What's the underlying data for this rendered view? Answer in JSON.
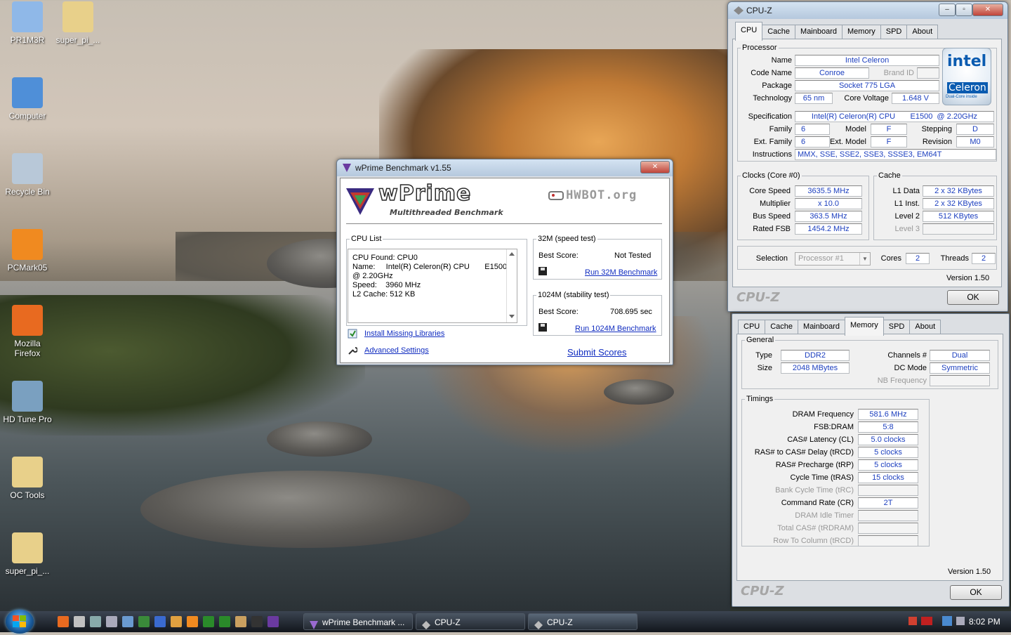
{
  "desktop": {
    "icons": [
      {
        "label": "PR1M3R",
        "color": "#8fb8e8"
      },
      {
        "label": "super_pi_...",
        "color": "#e8d08a"
      },
      {
        "label": "Computer",
        "color": "#4f8fd8"
      },
      {
        "label": "Recycle Bin",
        "color": "#b8c8d8"
      },
      {
        "label": "PCMark05",
        "color": "#f08a20"
      },
      {
        "label": "Mozilla Firefox",
        "color": "#e86a20"
      },
      {
        "label": "HD Tune Pro",
        "color": "#7aa0c0"
      },
      {
        "label": "OC Tools",
        "color": "#e8d08a"
      },
      {
        "label": "super_pi_...",
        "color": "#e8d08a"
      }
    ]
  },
  "wprime": {
    "title": "wPrime Benchmark v1.55",
    "logo": "wPrime",
    "logo_sub": "Multithreaded Benchmark",
    "hwbot": "HWBOT.org",
    "cpu_list": {
      "legend": "CPU List",
      "lines": [
        "CPU Found: CPU0",
        "Name:     Intel(R) Celeron(R) CPU       E1500",
        "@ 2.20GHz",
        "Speed:    3960 MHz",
        "L2 Cache: 512 KB"
      ]
    },
    "install_link": "Install Missing Libraries",
    "advanced_link": "Advanced Settings",
    "test32": {
      "legend": "32M (speed test)",
      "best_label": "Best Score:",
      "best_value": "Not Tested",
      "run": "Run 32M Benchmark"
    },
    "test1024": {
      "legend": "1024M (stability test)",
      "best_label": "Best Score:",
      "best_value": "708.695 sec",
      "run": "Run 1024M Benchmark"
    },
    "submit": "Submit Scores",
    "close_btn": "✕"
  },
  "cpuz1": {
    "title": "CPU-Z",
    "tabs": [
      "CPU",
      "Cache",
      "Mainboard",
      "Memory",
      "SPD",
      "About"
    ],
    "active_tab": "CPU",
    "processor": {
      "legend": "Processor",
      "name_label": "Name",
      "name": "Intel Celeron",
      "codename_label": "Code Name",
      "codename": "Conroe",
      "brand_label": "Brand ID",
      "package_label": "Package",
      "package": "Socket 775 LGA",
      "tech_label": "Technology",
      "tech": "65 nm",
      "voltage_label": "Core Voltage",
      "voltage": "1.648 V",
      "spec_label": "Specification",
      "spec": "Intel(R) Celeron(R) CPU       E1500  @ 2.20GHz",
      "family_label": "Family",
      "family": "6",
      "model_label": "Model",
      "model": "F",
      "stepping_label": "Stepping",
      "stepping": "D",
      "extfamily_label": "Ext. Family",
      "extfamily": "6",
      "extmodel_label": "Ext. Model",
      "extmodel": "F",
      "revision_label": "Revision",
      "revision": "M0",
      "instr_label": "Instructions",
      "instr": "MMX, SSE, SSE2, SSE3, SSSE3, EM64T"
    },
    "intel_logo": {
      "brand": "intel",
      "product": "Celeron",
      "tag": "Dual-Core inside"
    },
    "clocks": {
      "legend": "Clocks (Core #0)",
      "core_speed_label": "Core Speed",
      "core_speed": "3635.5 MHz",
      "multiplier_label": "Multiplier",
      "multiplier": "x 10.0",
      "bus_speed_label": "Bus Speed",
      "bus_speed": "363.5 MHz",
      "rated_fsb_label": "Rated FSB",
      "rated_fsb": "1454.2 MHz"
    },
    "cache": {
      "legend": "Cache",
      "l1d_label": "L1 Data",
      "l1d": "2 x 32 KBytes",
      "l1i_label": "L1 Inst.",
      "l1i": "2 x 32 KBytes",
      "l2_label": "Level 2",
      "l2": "512 KBytes",
      "l3_label": "Level 3"
    },
    "selection_label": "Selection",
    "selection": "Processor #1",
    "cores_label": "Cores",
    "cores": "2",
    "threads_label": "Threads",
    "threads": "2",
    "version": "Version 1.50",
    "brand": "CPU-Z",
    "ok": "OK"
  },
  "cpuz2": {
    "tabs": [
      "CPU",
      "Cache",
      "Mainboard",
      "Memory",
      "SPD",
      "About"
    ],
    "active_tab": "Memory",
    "general": {
      "legend": "General",
      "type_label": "Type",
      "type": "DDR2",
      "size_label": "Size",
      "size": "2048 MBytes",
      "channels_label": "Channels #",
      "channels": "Dual",
      "dcmode_label": "DC Mode",
      "dcmode": "Symmetric",
      "nbfreq_label": "NB Frequency"
    },
    "timings": {
      "legend": "Timings",
      "rows": [
        {
          "label": "DRAM Frequency",
          "value": "581.6 MHz",
          "gray": false
        },
        {
          "label": "FSB:DRAM",
          "value": "5:8",
          "gray": false
        },
        {
          "label": "CAS# Latency (CL)",
          "value": "5.0 clocks",
          "gray": false
        },
        {
          "label": "RAS# to CAS# Delay (tRCD)",
          "value": "5 clocks",
          "gray": false
        },
        {
          "label": "RAS# Precharge (tRP)",
          "value": "5 clocks",
          "gray": false
        },
        {
          "label": "Cycle Time (tRAS)",
          "value": "15 clocks",
          "gray": false
        },
        {
          "label": "Bank Cycle Time (tRC)",
          "value": "",
          "gray": true
        },
        {
          "label": "Command Rate (CR)",
          "value": "2T",
          "gray": false
        },
        {
          "label": "DRAM Idle Timer",
          "value": "",
          "gray": true
        },
        {
          "label": "Total CAS# (tRDRAM)",
          "value": "",
          "gray": true
        },
        {
          "label": "Row To Column (tRCD)",
          "value": "",
          "gray": true
        }
      ]
    },
    "version": "Version 1.50",
    "brand": "CPU-Z",
    "ok": "OK"
  },
  "taskbar": {
    "items": [
      "wPrime Benchmark ...",
      "CPU-Z",
      "CPU-Z"
    ],
    "clock": "8:02 PM"
  }
}
